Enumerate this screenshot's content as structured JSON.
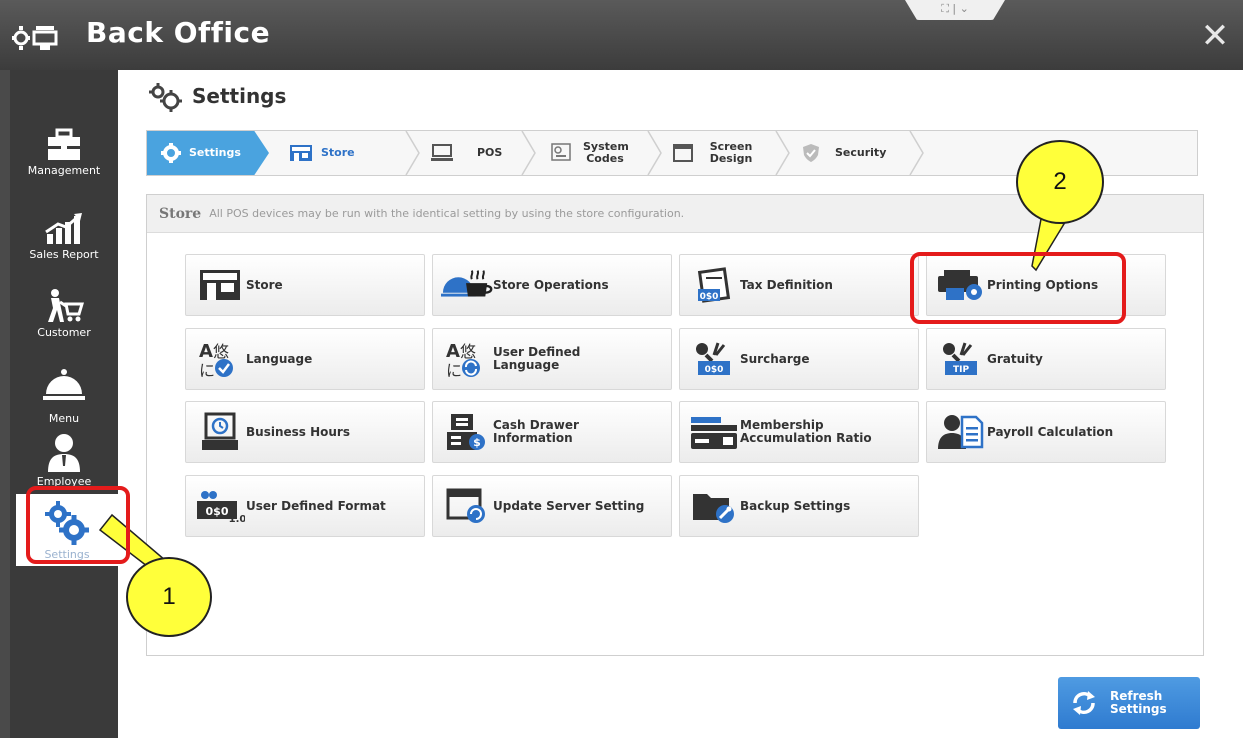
{
  "window": {
    "title": "Back Office",
    "close_glyph": "✕",
    "handle_glyph": "⛶ | ⌄"
  },
  "sidebar": {
    "items": [
      {
        "label": "Management",
        "icon": "briefcase-icon"
      },
      {
        "label": "Sales Report",
        "icon": "chart-icon"
      },
      {
        "label": "Customer",
        "icon": "customer-cart-icon"
      },
      {
        "label": "Menu",
        "icon": "cloche-icon"
      },
      {
        "label": "Employee",
        "icon": "employee-icon"
      },
      {
        "label": "Settings",
        "icon": "gears-icon"
      }
    ],
    "selected": "Settings"
  },
  "page": {
    "title": "Settings"
  },
  "breadcrumb": {
    "steps": [
      {
        "label": "Settings",
        "icon": "gear-icon",
        "active": true
      },
      {
        "label": "Store",
        "icon": "store-icon"
      },
      {
        "label": "POS",
        "icon": "pos-icon"
      },
      {
        "label": "System Codes",
        "icon": "system-codes-icon"
      },
      {
        "label": "Screen Design",
        "icon": "screen-icon"
      },
      {
        "label": "Security",
        "icon": "shield-icon"
      }
    ]
  },
  "panel": {
    "title": "Store",
    "description": "All POS devices may be run with the identical setting by using the store configuration.",
    "tiles": [
      {
        "label": "Store",
        "icon": "store-icon"
      },
      {
        "label": "Store Operations",
        "icon": "cloche-coffee-icon"
      },
      {
        "label": "Tax Definition",
        "icon": "tax-icon"
      },
      {
        "label": "Printing Options",
        "icon": "printer-icon"
      },
      {
        "label": "Language",
        "icon": "language-icon"
      },
      {
        "label": "User Defined Language",
        "icon": "user-language-icon"
      },
      {
        "label": "Surcharge",
        "icon": "surcharge-icon"
      },
      {
        "label": "Gratuity",
        "icon": "gratuity-icon"
      },
      {
        "label": "Business Hours",
        "icon": "clock-register-icon"
      },
      {
        "label": "Cash Drawer Information",
        "icon": "cash-drawer-icon"
      },
      {
        "label": "Membership Accumulation Ratio",
        "icon": "membership-card-icon"
      },
      {
        "label": "Payroll Calculation",
        "icon": "payroll-icon"
      },
      {
        "label": "User Defined Format",
        "icon": "format-icon"
      },
      {
        "label": "Update Server Setting",
        "icon": "update-server-icon"
      },
      {
        "label": "Backup Settings",
        "icon": "backup-icon"
      }
    ]
  },
  "refresh": {
    "label": "Refresh Settings",
    "icon": "refresh-icon"
  },
  "annotations": {
    "callout_1": "1",
    "callout_2": "2"
  },
  "colors": {
    "accent": "#4aa3df",
    "highlight": "#e41b1b",
    "callout": "#ffff3a",
    "sidebar": "#3a3a3a"
  }
}
